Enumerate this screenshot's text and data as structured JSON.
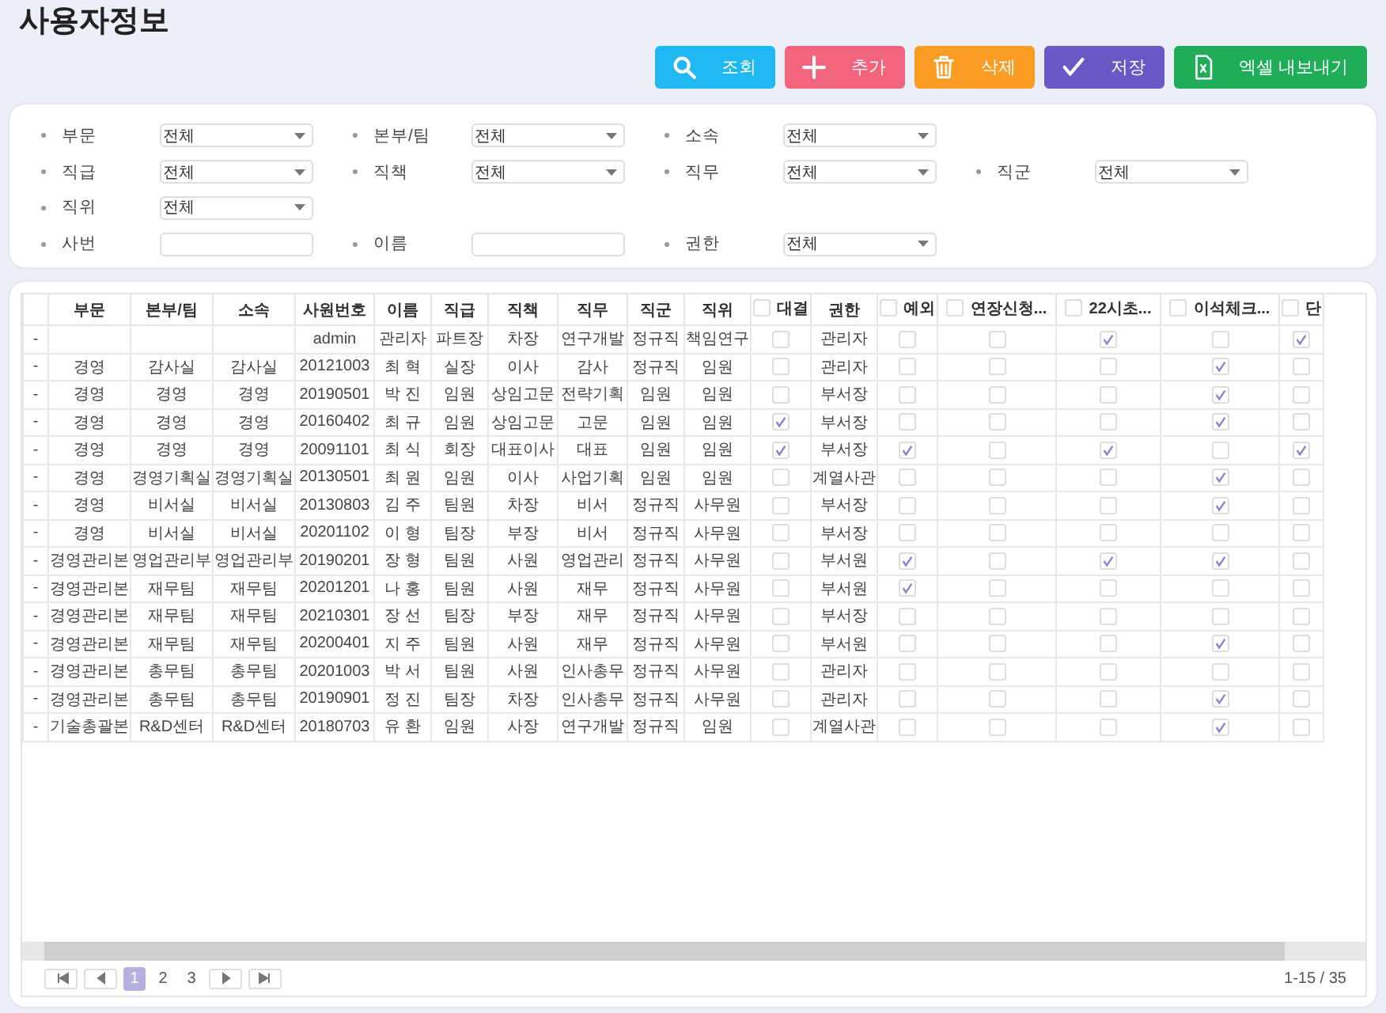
{
  "page_title": "사용자정보",
  "actions": [
    {
      "label": "조회",
      "color": "#1fb8f0"
    },
    {
      "label": "추가",
      "color": "#f2647c"
    },
    {
      "label": "삭제",
      "color": "#fb9d24"
    },
    {
      "label": "저장",
      "color": "#6a58c6"
    },
    {
      "label": "엑셀 내보내기",
      "color": "#20ad5a"
    }
  ],
  "filters": [
    [
      {
        "label": "부문",
        "kind": "select",
        "value": "전체"
      },
      {
        "label": "본부/팀",
        "kind": "select",
        "value": "전체"
      },
      {
        "label": "소속",
        "kind": "select",
        "value": "전체"
      }
    ],
    [
      {
        "label": "직급",
        "kind": "select",
        "value": "전체"
      },
      {
        "label": "직책",
        "kind": "select",
        "value": "전체"
      },
      {
        "label": "직무",
        "kind": "select",
        "value": "전체"
      },
      {
        "label": "직군",
        "kind": "select",
        "value": "전체"
      }
    ],
    [
      {
        "label": "직위",
        "kind": "select",
        "value": "전체"
      }
    ],
    [
      {
        "label": "사번",
        "kind": "text"
      },
      {
        "label": "이름",
        "kind": "text"
      },
      {
        "label": "권한",
        "kind": "select",
        "value": "전체"
      }
    ]
  ],
  "table": {
    "columns": [
      {
        "kind": "text",
        "label": "부문"
      },
      {
        "kind": "text",
        "label": "본부/팀"
      },
      {
        "kind": "text",
        "label": "소속"
      },
      {
        "kind": "text",
        "label": "사원번호"
      },
      {
        "kind": "text",
        "label": "이름"
      },
      {
        "kind": "text",
        "label": "직급"
      },
      {
        "kind": "text",
        "label": "직책"
      },
      {
        "kind": "text",
        "label": "직무"
      },
      {
        "kind": "text",
        "label": "직군"
      },
      {
        "kind": "text",
        "label": "직위"
      },
      {
        "kind": "check",
        "label": "대결",
        "checked": false
      },
      {
        "kind": "text",
        "label": "권한"
      },
      {
        "kind": "check",
        "label": "예외",
        "checked": false
      },
      {
        "kind": "check",
        "label": "연장신청...",
        "checked": false
      },
      {
        "kind": "check",
        "label": "22시초...",
        "checked": false
      },
      {
        "kind": "check",
        "label": "이석체크...",
        "checked": false
      },
      {
        "kind": "check",
        "label": "단",
        "checked": false
      }
    ],
    "rows": [
      {
        "marker": "-",
        "cells": [
          null,
          null,
          null,
          "admin",
          "관리자",
          "파트장",
          "차장",
          "연구개발",
          "정규직",
          "책임연구",
          {
            "checked": false
          },
          "관리자",
          {
            "checked": false
          },
          {
            "checked": false
          },
          {
            "checked": true
          },
          {
            "checked": false
          },
          {
            "checked": true
          }
        ]
      },
      {
        "marker": "-",
        "cells": [
          "경영",
          "감사실",
          "감사실",
          "20121003",
          "최 혁",
          "실장",
          "이사",
          "감사",
          "정규직",
          "임원",
          {
            "checked": false
          },
          "관리자",
          {
            "checked": false
          },
          {
            "checked": false
          },
          {
            "checked": false
          },
          {
            "checked": true
          },
          {
            "checked": false
          }
        ]
      },
      {
        "marker": "-",
        "cells": [
          "경영",
          "경영",
          "경영",
          "20190501",
          "박 진",
          "임원",
          "상임고문",
          "전략기획",
          "임원",
          "임원",
          {
            "checked": false
          },
          "부서장",
          {
            "checked": false
          },
          {
            "checked": false
          },
          {
            "checked": false
          },
          {
            "checked": true
          },
          {
            "checked": false
          }
        ]
      },
      {
        "marker": "-",
        "cells": [
          "경영",
          "경영",
          "경영",
          "20160402",
          "최 규",
          "임원",
          "상임고문",
          "고문",
          "임원",
          "임원",
          {
            "checked": true
          },
          "부서장",
          {
            "checked": false
          },
          {
            "checked": false
          },
          {
            "checked": false
          },
          {
            "checked": true
          },
          {
            "checked": false
          }
        ]
      },
      {
        "marker": "-",
        "cells": [
          "경영",
          "경영",
          "경영",
          "20091101",
          "최 식",
          "회장",
          "대표이사",
          "대표",
          "임원",
          "임원",
          {
            "checked": true
          },
          "부서장",
          {
            "checked": true
          },
          {
            "checked": false
          },
          {
            "checked": true
          },
          {
            "checked": false
          },
          {
            "checked": true
          }
        ]
      },
      {
        "marker": "-",
        "cells": [
          "경영",
          "경영기획실",
          "경영기획실",
          "20130501",
          "최 원",
          "임원",
          "이사",
          "사업기획",
          "임원",
          "임원",
          {
            "checked": false
          },
          "계열사관",
          {
            "checked": false
          },
          {
            "checked": false
          },
          {
            "checked": false
          },
          {
            "checked": true
          },
          {
            "checked": false
          }
        ]
      },
      {
        "marker": "-",
        "cells": [
          "경영",
          "비서실",
          "비서실",
          "20130803",
          "김 주",
          "팀원",
          "차장",
          "비서",
          "정규직",
          "사무원",
          {
            "checked": false
          },
          "부서장",
          {
            "checked": false
          },
          {
            "checked": false
          },
          {
            "checked": false
          },
          {
            "checked": true
          },
          {
            "checked": false
          }
        ]
      },
      {
        "marker": "-",
        "cells": [
          "경영",
          "비서실",
          "비서실",
          "20201102",
          "이 형",
          "팀장",
          "부장",
          "비서",
          "정규직",
          "사무원",
          {
            "checked": false
          },
          "부서장",
          {
            "checked": false
          },
          {
            "checked": false
          },
          {
            "checked": false
          },
          {
            "checked": false
          },
          {
            "checked": false
          }
        ]
      },
      {
        "marker": "-",
        "cells": [
          "경영관리본",
          "영업관리부",
          "영업관리부",
          "20190201",
          "장 형",
          "팀원",
          "사원",
          "영업관리",
          "정규직",
          "사무원",
          {
            "checked": false
          },
          "부서원",
          {
            "checked": true
          },
          {
            "checked": false
          },
          {
            "checked": true
          },
          {
            "checked": true
          },
          {
            "checked": false
          }
        ]
      },
      {
        "marker": "-",
        "cells": [
          "경영관리본",
          "재무팀",
          "재무팀",
          "20201201",
          "나 홍",
          "팀원",
          "사원",
          "재무",
          "정규직",
          "사무원",
          {
            "checked": false
          },
          "부서원",
          {
            "checked": true
          },
          {
            "checked": false
          },
          {
            "checked": false
          },
          {
            "checked": false
          },
          {
            "checked": false
          }
        ]
      },
      {
        "marker": "-",
        "cells": [
          "경영관리본",
          "재무팀",
          "재무팀",
          "20210301",
          "장 선",
          "팀장",
          "부장",
          "재무",
          "정규직",
          "사무원",
          {
            "checked": false
          },
          "부서장",
          {
            "checked": false
          },
          {
            "checked": false
          },
          {
            "checked": false
          },
          {
            "checked": false
          },
          {
            "checked": false
          }
        ]
      },
      {
        "marker": "-",
        "cells": [
          "경영관리본",
          "재무팀",
          "재무팀",
          "20200401",
          "지 주",
          "팀원",
          "사원",
          "재무",
          "정규직",
          "사무원",
          {
            "checked": false
          },
          "부서원",
          {
            "checked": false
          },
          {
            "checked": false
          },
          {
            "checked": false
          },
          {
            "checked": true
          },
          {
            "checked": false
          }
        ]
      },
      {
        "marker": "-",
        "cells": [
          "경영관리본",
          "총무팀",
          "총무팀",
          "20201003",
          "박 서",
          "팀원",
          "사원",
          "인사총무",
          "정규직",
          "사무원",
          {
            "checked": false
          },
          "관리자",
          {
            "checked": false
          },
          {
            "checked": false
          },
          {
            "checked": false
          },
          {
            "checked": false
          },
          {
            "checked": false
          }
        ]
      },
      {
        "marker": "-",
        "cells": [
          "경영관리본",
          "총무팀",
          "총무팀",
          "20190901",
          "정 진",
          "팀장",
          "차장",
          "인사총무",
          "정규직",
          "사무원",
          {
            "checked": false
          },
          "관리자",
          {
            "checked": false
          },
          {
            "checked": false
          },
          {
            "checked": false
          },
          {
            "checked": true
          },
          {
            "checked": false
          }
        ]
      },
      {
        "marker": "-",
        "cells": [
          "기술총괄본",
          "R&D센터",
          "R&D센터",
          "20180703",
          "유 환",
          "임원",
          "사장",
          "연구개발",
          "정규직",
          "임원",
          {
            "checked": false
          },
          "계열사관",
          {
            "checked": false
          },
          {
            "checked": false
          },
          {
            "checked": false
          },
          {
            "checked": true
          },
          {
            "checked": false
          }
        ]
      }
    ]
  },
  "pager": {
    "pages": [
      {
        "label": "1",
        "selected": true
      },
      {
        "label": "2",
        "selected": false
      },
      {
        "label": "3",
        "selected": false
      }
    ],
    "range": "1-15 / 35"
  }
}
